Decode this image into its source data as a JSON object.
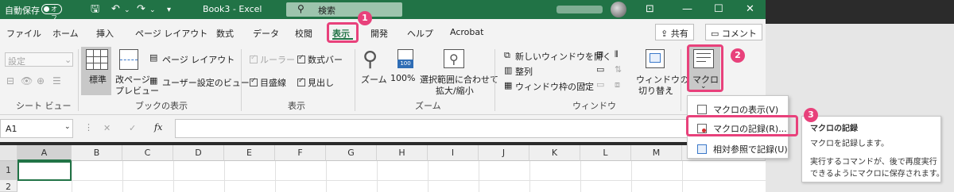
{
  "titlebar": {
    "autosave_label": "自動保存",
    "autosave_state": "オフ",
    "title": "Book3  -  Excel",
    "search_label": "検索"
  },
  "tabs": [
    "ファイル",
    "ホーム",
    "挿入",
    "ページ レイアウト",
    "数式",
    "データ",
    "校閲",
    "表示",
    "開発",
    "ヘルプ",
    "Acrobat"
  ],
  "share_label": "共有",
  "comment_label": "コメント",
  "ribbon": {
    "sheetview": {
      "dropdown": "設定",
      "group": "シート ビュー"
    },
    "workbook": {
      "normal": "標準",
      "pagebreak_line1": "改ページ",
      "pagebreak_line2": "プレビュー",
      "pagelayout": "ページ レイアウト",
      "custom": "ユーザー設定のビュー",
      "group": "ブックの表示"
    },
    "show": {
      "ruler": "ルーラー",
      "formulabar": "数式バー",
      "gridlines": "目盛線",
      "headings": "見出し",
      "group": "表示"
    },
    "zoom": {
      "zoom": "ズーム",
      "hundred": "100%",
      "fit_line1": "選択範囲に合わせて",
      "fit_line2": "拡大/縮小",
      "group": "ズーム",
      "icon_text": "100"
    },
    "window": {
      "new": "新しいウィンドウを開く",
      "arrange": "整列",
      "freeze": "ウィンドウ枠の固定",
      "switch_line1": "ウィンドウの",
      "switch_line2": "切り替え",
      "group": "ウィンドウ"
    },
    "macro": {
      "label": "マクロ"
    }
  },
  "formula_bar": {
    "name_box": "A1",
    "cancel": "✕",
    "enter": "✓",
    "fx": "fx"
  },
  "columns": [
    "A",
    "B",
    "C",
    "D",
    "E",
    "F",
    "G",
    "H",
    "I",
    "J",
    "K",
    "L",
    "M"
  ],
  "rows": [
    "1",
    "2"
  ],
  "menu": {
    "view": "マクロの表示(V)",
    "record": "マクロの記録(R)...",
    "relative": "相対参照で記録(U)"
  },
  "tooltip": {
    "title": "マクロの記録",
    "line1": "マクロを記録します。",
    "line2": "実行するコマンドが、後で再度実行",
    "line3": "できるようにマクロに保存されます。"
  },
  "badges": [
    "1",
    "2",
    "3"
  ],
  "colors": {
    "excel_green": "#217346",
    "callout_pink": "#e8417b"
  }
}
